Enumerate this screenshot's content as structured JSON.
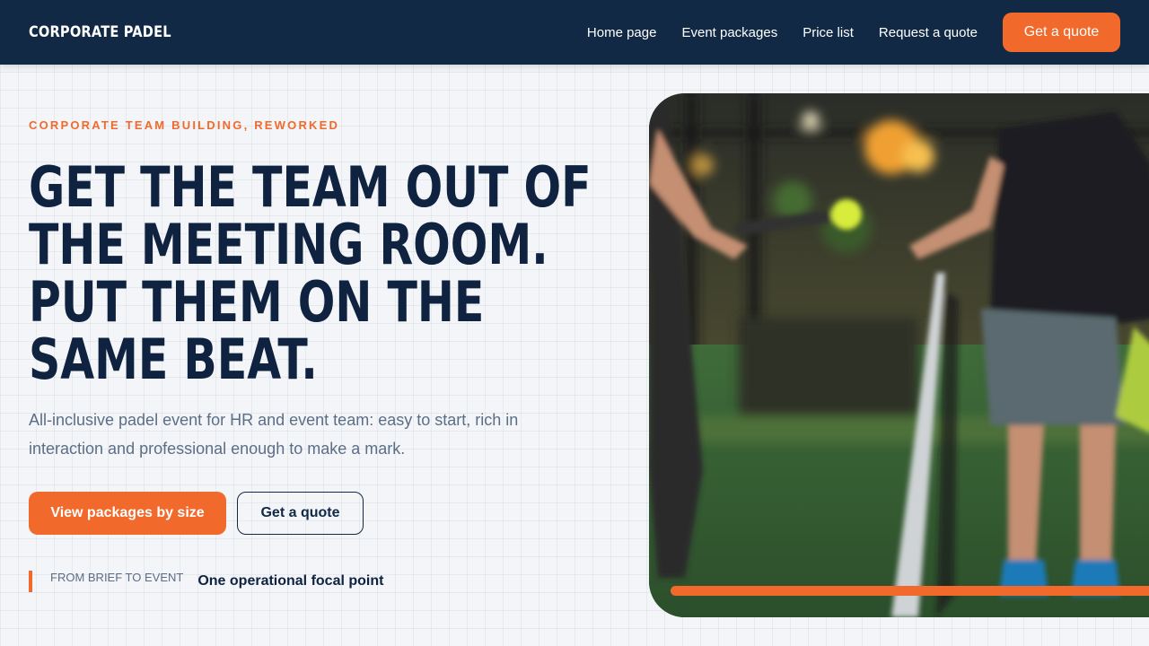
{
  "nav": {
    "brand": "CORPORATE PADEL",
    "links": [
      "Home page",
      "Event packages",
      "Price list",
      "Request a quote"
    ],
    "cta": "Get a quote"
  },
  "hero": {
    "eyebrow": "CORPORATE TEAM BUILDING, REWORKED",
    "headline": "GET THE TEAM OUT OF THE MEETING ROOM. PUT THEM ON THE SAME BEAT.",
    "subtitle": "All-inclusive padel event for HR and event team: easy to start, rich in interaction and professional enough to make a mark.",
    "primary_button": "View packages by size",
    "secondary_button": "Get a quote",
    "focal_label": "FROM BRIEF TO EVENT",
    "focal_value": "One operational focal point"
  },
  "colors": {
    "navy": "#112944",
    "accent": "#f26a2b",
    "muted": "#5c6e86"
  }
}
